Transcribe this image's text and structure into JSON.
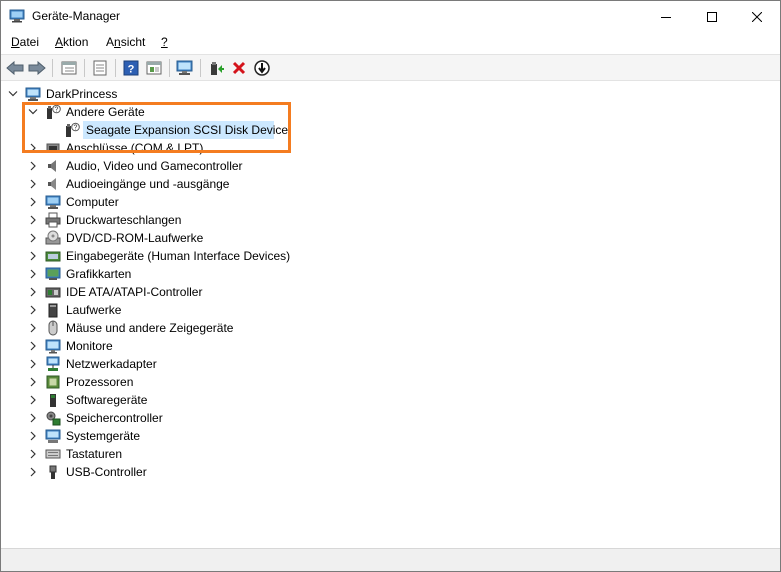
{
  "window": {
    "title": "Geräte-Manager"
  },
  "menu": [
    {
      "label": "Datei",
      "accel": "D"
    },
    {
      "label": "Aktion",
      "accel": "A"
    },
    {
      "label": "Ansicht",
      "accel": "n"
    },
    {
      "label": "?",
      "accel": "?"
    }
  ],
  "toolbar": {
    "buttons": [
      "back-icon",
      "forward-icon",
      "properties-view-icon",
      "properties-icon",
      "help-icon",
      "show-hidden-icon",
      "scan-hardware-icon",
      "update-driver-icon",
      "uninstall-icon",
      "disable-icon"
    ]
  },
  "tree": {
    "root": "DarkPrincess",
    "open_category": "Andere Geräte",
    "selected_device": "Seagate Expansion SCSI Disk Device",
    "categories": [
      "Anschlüsse (COM & LPT)",
      "Audio, Video und Gamecontroller",
      "Audioeingänge und -ausgänge",
      "Computer",
      "Druckwarteschlangen",
      "DVD/CD-ROM-Laufwerke",
      "Eingabegeräte (Human Interface Devices)",
      "Grafikkarten",
      "IDE ATA/ATAPI-Controller",
      "Laufwerke",
      "Mäuse und andere Zeigegeräte",
      "Monitore",
      "Netzwerkadapter",
      "Prozessoren",
      "Softwaregeräte",
      "Speichercontroller",
      "Systemgeräte",
      "Tastaturen",
      "USB-Controller"
    ]
  },
  "colors": {
    "highlight_border": "#f47c20",
    "selection": "#cce8ff",
    "toolbar_bg": "#f5f5f5"
  }
}
